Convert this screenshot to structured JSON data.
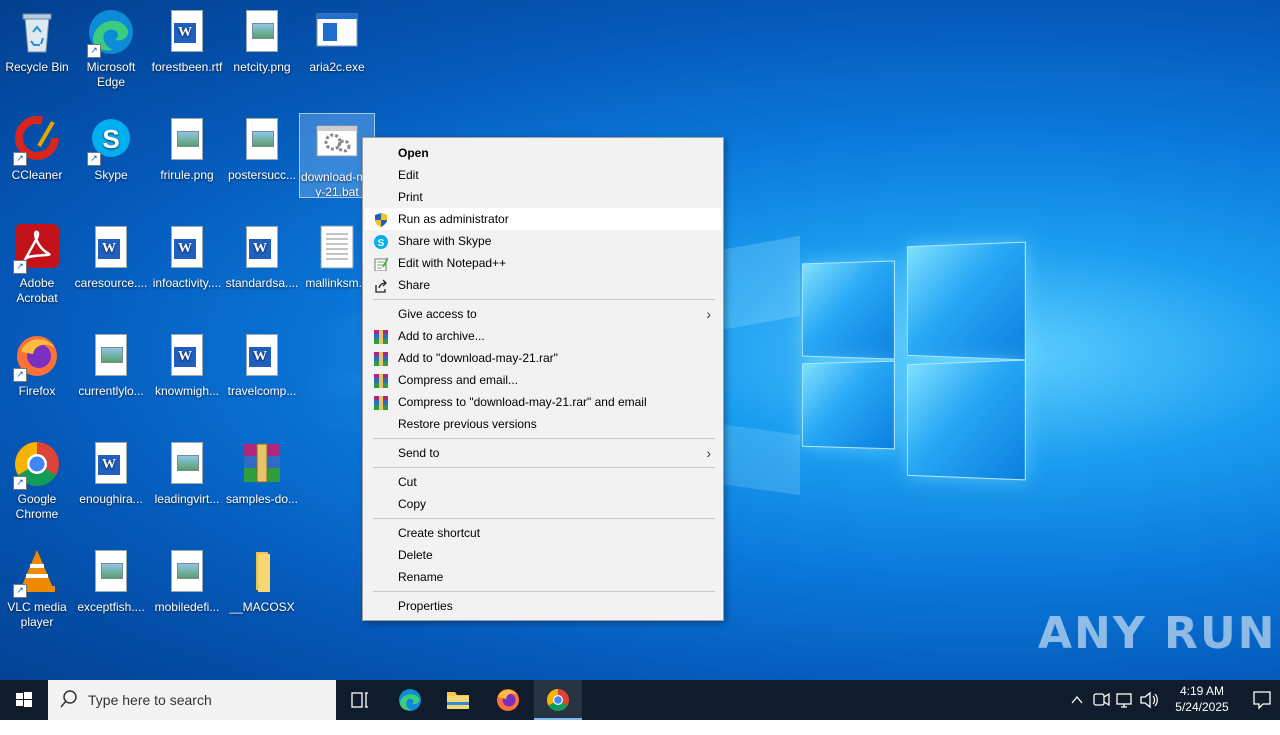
{
  "desktop": {
    "icons": [
      {
        "label": "Recycle Bin"
      },
      {
        "label": "Microsoft Edge"
      },
      {
        "label": "forestbeen.rtf"
      },
      {
        "label": "netcity.png"
      },
      {
        "label": "aria2c.exe"
      },
      {
        "label": "CCleaner"
      },
      {
        "label": "Skype"
      },
      {
        "label": "frirule.png"
      },
      {
        "label": "postersucc..."
      },
      {
        "label": "download-may-21.bat"
      },
      {
        "label": "Adobe Acrobat"
      },
      {
        "label": "caresource...."
      },
      {
        "label": "infoactivity...."
      },
      {
        "label": "standardsa...."
      },
      {
        "label": "mallinksm..."
      },
      {
        "label": "Firefox"
      },
      {
        "label": "currentlylo..."
      },
      {
        "label": "knowmigh..."
      },
      {
        "label": "travelcomp..."
      },
      {
        "label": "Google Chrome"
      },
      {
        "label": "enoughira..."
      },
      {
        "label": "leadingvirt..."
      },
      {
        "label": "samples-do..."
      },
      {
        "label": "VLC media player"
      },
      {
        "label": "exceptfish...."
      },
      {
        "label": "mobiledefi..."
      },
      {
        "label": "__MACOSX"
      }
    ]
  },
  "context_menu": {
    "items": [
      {
        "label": "Open"
      },
      {
        "label": "Edit"
      },
      {
        "label": "Print"
      },
      {
        "label": "Run as administrator",
        "icon": "shield-icon"
      },
      {
        "label": "Share with Skype",
        "icon": "skype-icon"
      },
      {
        "label": "Edit with Notepad++",
        "icon": "notepadpp-icon"
      },
      {
        "label": "Share",
        "icon": "share-icon"
      },
      {
        "label": "Give access to",
        "submenu": true
      },
      {
        "label": "Add to archive...",
        "icon": "winrar-icon"
      },
      {
        "label": "Add to \"download-may-21.rar\"",
        "icon": "winrar-icon"
      },
      {
        "label": "Compress and email...",
        "icon": "winrar-icon"
      },
      {
        "label": "Compress to \"download-may-21.rar\" and email",
        "icon": "winrar-icon"
      },
      {
        "label": "Restore previous versions"
      },
      {
        "label": "Send to",
        "submenu": true
      },
      {
        "label": "Cut"
      },
      {
        "label": "Copy"
      },
      {
        "label": "Create shortcut"
      },
      {
        "label": "Delete"
      },
      {
        "label": "Rename"
      },
      {
        "label": "Properties"
      }
    ],
    "highlighted": "Run as administrator"
  },
  "taskbar": {
    "search_placeholder": "Type here to search",
    "pinned": [
      "task-view-icon",
      "edge-icon",
      "file-explorer-icon",
      "firefox-icon",
      "chrome-icon"
    ],
    "time": "4:19 AM",
    "date": "5/24/2025"
  },
  "watermark": "ANY RUN",
  "colors": {
    "accent": "#0a78da",
    "taskbar": "#101c2c",
    "menu_bg": "#f2f2f2"
  }
}
